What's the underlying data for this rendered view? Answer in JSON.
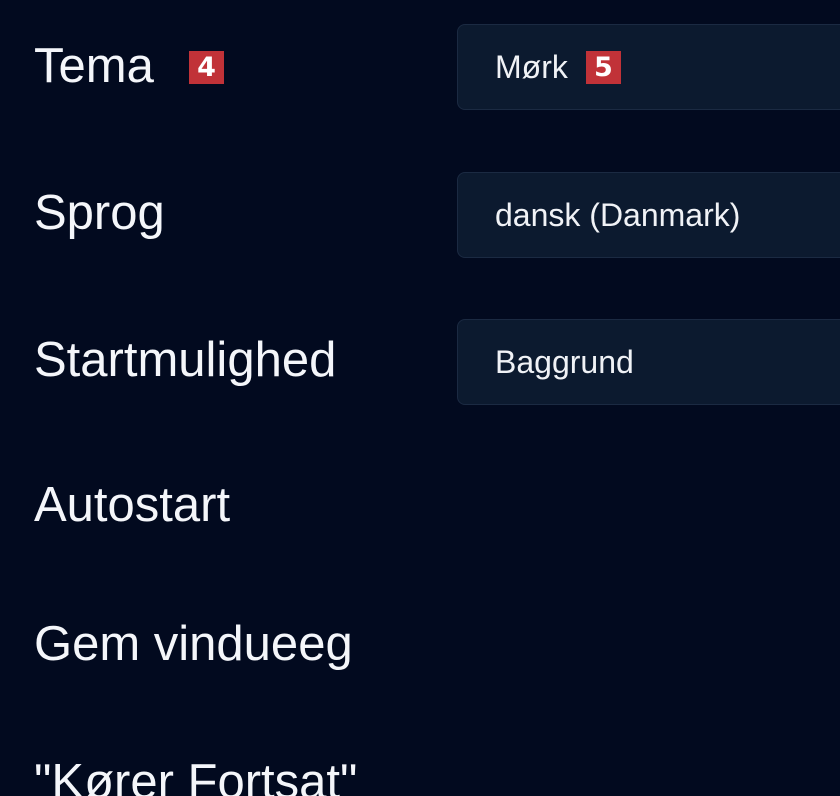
{
  "settings": {
    "theme": {
      "label": "Tema",
      "badge": "4",
      "value": "Mørk",
      "value_badge": "5"
    },
    "language": {
      "label": "Sprog",
      "value": "dansk (Danmark)"
    },
    "startup": {
      "label": "Startmulighed",
      "value": "Baggrund"
    },
    "autostart": {
      "label": "Autostart"
    },
    "save_window": {
      "label": "Gem vindueeg"
    },
    "keep_running": {
      "label": "\"Kører Fortsat\""
    }
  },
  "colors": {
    "background": "#020a1f",
    "select_background": "#0c1a2f",
    "badge": "#c13238"
  }
}
